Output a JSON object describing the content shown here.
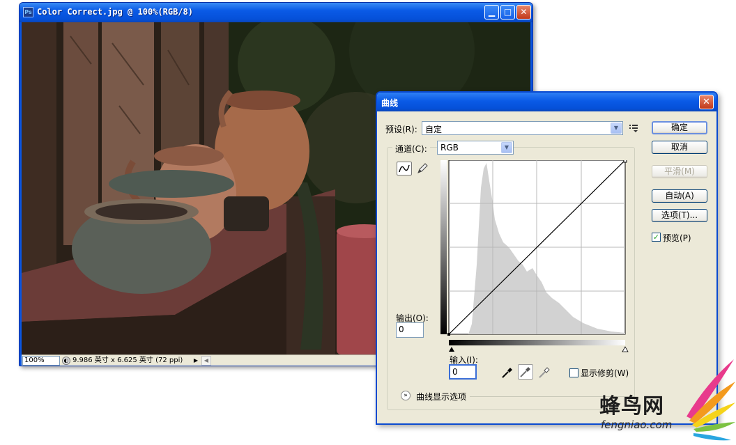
{
  "document_window": {
    "title": "Color Correct.jpg @ 100%(RGB/8)",
    "app_icon": "Ps",
    "zoom": "100%",
    "doc_size": "9.986 英寸 x 6.625 英寸 (72 ppi)"
  },
  "curves_dialog": {
    "title": "曲线",
    "preset_label": "预设(R):",
    "preset_value": "自定",
    "channel_label": "通道(C):",
    "channel_value": "RGB",
    "output_label": "输出(O):",
    "output_value": "0",
    "input_label": "输入(I):",
    "input_value": "0",
    "show_clipping_label": "显示修剪(W)",
    "show_clipping_checked": false,
    "curve_display_options_label": "曲线显示选项",
    "buttons": {
      "ok": "确定",
      "cancel": "取消",
      "smooth": "平滑(M)",
      "auto": "自动(A)",
      "options": "选项(T)..."
    },
    "preview_label": "预览(P)",
    "preview_checked": true
  },
  "watermark": {
    "name": "蜂鸟网",
    "url": "fengniao.com"
  },
  "colors": {
    "xp_title_blue": "#0a5ae6",
    "dialog_bg": "#ece9d8",
    "histogram_gray": "#d2d2d2"
  }
}
